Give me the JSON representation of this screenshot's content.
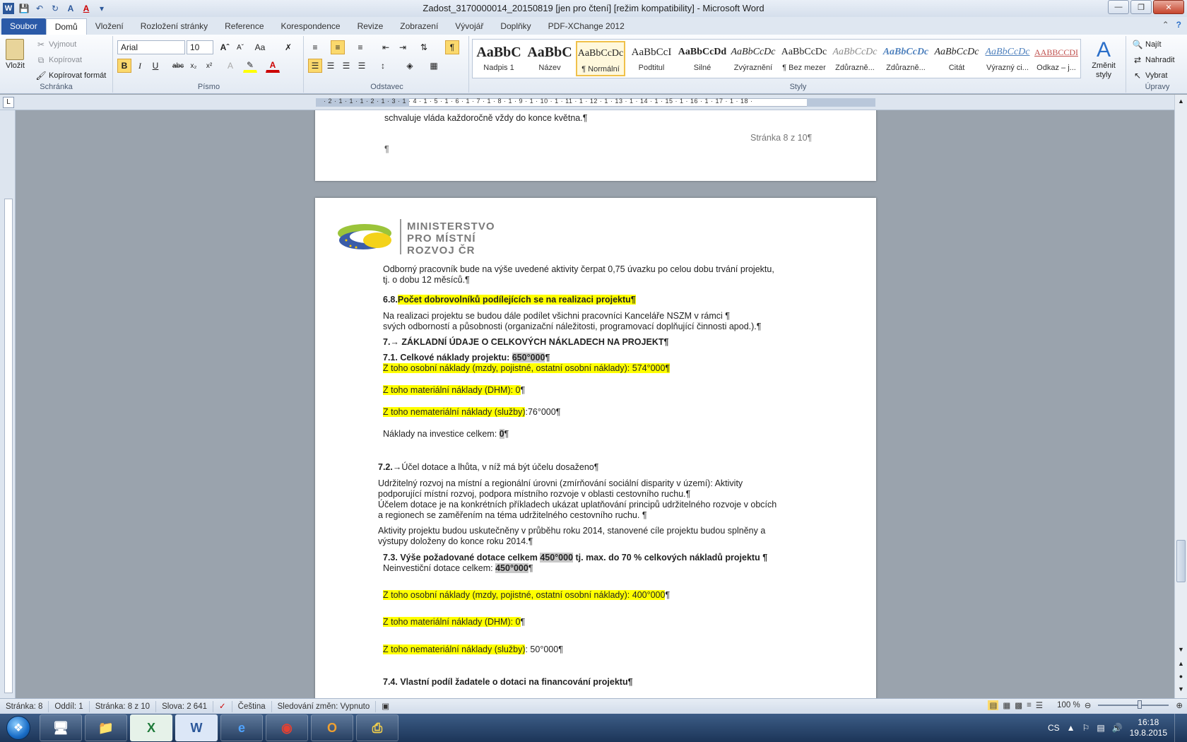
{
  "window": {
    "title": "Zadost_3170000014_20150819 [jen pro čtení] [režim kompatibility]  -  Microsoft Word",
    "qat_icons": [
      "word-logo-icon",
      "save-icon",
      "undo-icon",
      "redo-icon",
      "format-painter-icon",
      "font-color-icon",
      "customize-icon"
    ]
  },
  "tabs": [
    "Soubor",
    "Domů",
    "Vložení",
    "Rozložení stránky",
    "Reference",
    "Korespondence",
    "Revize",
    "Zobrazení",
    "Vývojář",
    "Doplňky",
    "PDF-XChange 2012"
  ],
  "ribbon": {
    "clipboard": {
      "paste": "Vložit",
      "cut": "Vyjmout",
      "copy": "Kopírovat",
      "format_painter": "Kopírovat formát",
      "label": "Schránka"
    },
    "font": {
      "name": "Arial",
      "size": "10",
      "label": "Písmo"
    },
    "paragraph": {
      "label": "Odstavec"
    },
    "styles": {
      "label": "Styly",
      "items": [
        {
          "preview": "AaBbC",
          "name": "Nadpis 1"
        },
        {
          "preview": "AaBbC",
          "name": "Název"
        },
        {
          "preview": "AaBbCcDc",
          "name": "¶ Normální"
        },
        {
          "preview": "AaBbCcI",
          "name": "Podtitul"
        },
        {
          "preview": "AaBbCcDd",
          "name": "Silné"
        },
        {
          "preview": "AaBbCcDc",
          "name": "Zvýraznění"
        },
        {
          "preview": "AaBbCcDc",
          "name": "¶ Bez mezer"
        },
        {
          "preview": "AaBbCcDc",
          "name": "Zdůrazně..."
        },
        {
          "preview": "AaBbCcDc",
          "name": "Zdůrazně..."
        },
        {
          "preview": "AaBbCcDc",
          "name": "Citát"
        },
        {
          "preview": "AaBbCcDc",
          "name": "Výrazný ci..."
        },
        {
          "preview": "AABBCCDI",
          "name": "Odkaz – j..."
        }
      ],
      "change": "Změnit styly"
    },
    "editing": {
      "find": "Najít",
      "replace": "Nahradit",
      "select": "Vybrat",
      "label": "Úpravy"
    }
  },
  "ruler": {
    "numbers": "· 2 · 1 · 1 · 1 · 2 · 1 · 3 · 1 · 4 · 1 · 5 · 1 · 6 · 1 · 7 · 1 · 8 · 1 · 9 · 1 · 10 · 1 · 11 · 1 · 12 · 1 · 13 · 1 · 14 · 1 · 15 · 1 · 16 · 1 · 17 · 1 · 18 ·"
  },
  "page1": {
    "top_line": "schvaluje vláda každoročně vždy do konce května.¶",
    "page_number": "Stránka 8 z 10¶",
    "empty": "¶"
  },
  "page2": {
    "logo": {
      "line1": "MINISTERSTVO",
      "line2": "PRO MÍSTNÍ",
      "line3": "ROZVOJ ČR"
    },
    "p1a": "Odborný pracovník bude na výše uvedené aktivity čerpat 0,75 úvazku po celou dobu trvání projektu,",
    "p1b": "tj. o dobu 12 měsíců.¶",
    "h68_num": "6.8.",
    "h68_text": "Počet dobrovolníků podílejících se na realizaci projektu¶",
    "p2a": "Na realizaci projektu se budou dále podílet všichni pracovníci Kanceláře NSZM v rámci ¶",
    "p2b": "svých odborností a působnosti (organizační náležitosti, programovací doplňující činnosti apod.).¶",
    "h7": "7.→ ZÁKLADNÍ ÚDAJE O CELKOVÝCH NÁKLADECH NA PROJEKT¶",
    "h71_label": "7.1. Celkové náklady projektu: ",
    "h71_value": "650°000",
    "h71_end": "¶",
    "c1": "Z toho osobní náklady (mzdy, pojistné, ostatní osobní náklady): 574°000¶",
    "c2": "Z toho materiální náklady (DHM): 0",
    "c2end": "¶",
    "c3": "Z toho nemateriální náklady (služby)",
    "c3val": ":76°000¶",
    "inv_label": "Náklady na investice celkem: ",
    "inv_value": "0",
    "inv_end": "¶",
    "h72_num": "7.2.→",
    "h72_text": "Účel dotace a lhůta, v níž má být účelu dosaženo¶",
    "p3a": "Udržitelný rozvoj na místní a regionální úrovni (zmírňování sociální disparity v území): Aktivity",
    "p3b": "podporující místní rozvoj, podpora místního rozvoje v oblasti cestovního ruchu.¶",
    "p3c": "Účelem dotace je na konkrétních příkladech ukázat uplatňování principů udržitelného rozvoje v obcích",
    "p3d": "a regionech se zaměřením na téma udržitelného cestovního ruchu. ¶",
    "p4a": "Aktivity projektu budou uskutečněny v průběhu roku 2014, stanovené cíle projektu budou splněny a",
    "p4b": "výstupy doloženy do konce roku 2014.¶",
    "h73_a": "7.3. Výše požadované dotace celkem ",
    "h73_val": "450°000",
    "h73_b": " tj. max. do 70 % celkových nákladů projektu ¶",
    "neinv_label": "Neinvestiční dotace celkem: ",
    "neinv_value": "450°000",
    "neinv_end": "¶",
    "d1": "Z toho osobní náklady (mzdy, pojistné, ostatní osobní náklady): 400°000",
    "d1end": "¶",
    "d2": "Z toho materiální náklady (DHM): 0",
    "d2end": "¶",
    "d3": "Z toho nemateriální náklady (služby)",
    "d3val": ": 50°000¶",
    "h74": "7.4. Vlastní podíl žadatele o dotaci na financování projektu¶"
  },
  "status": {
    "page": "Stránka: 8",
    "section": "Oddíl: 1",
    "pageof": "Stránka: 8 z 10",
    "words": "Slova: 2 641",
    "lang": "Čeština",
    "track": "Sledování změn: Vypnuto",
    "zoom": "100 %"
  },
  "taskbar": {
    "lang": "CS",
    "time": "16:18",
    "date": "19.8.2015"
  }
}
